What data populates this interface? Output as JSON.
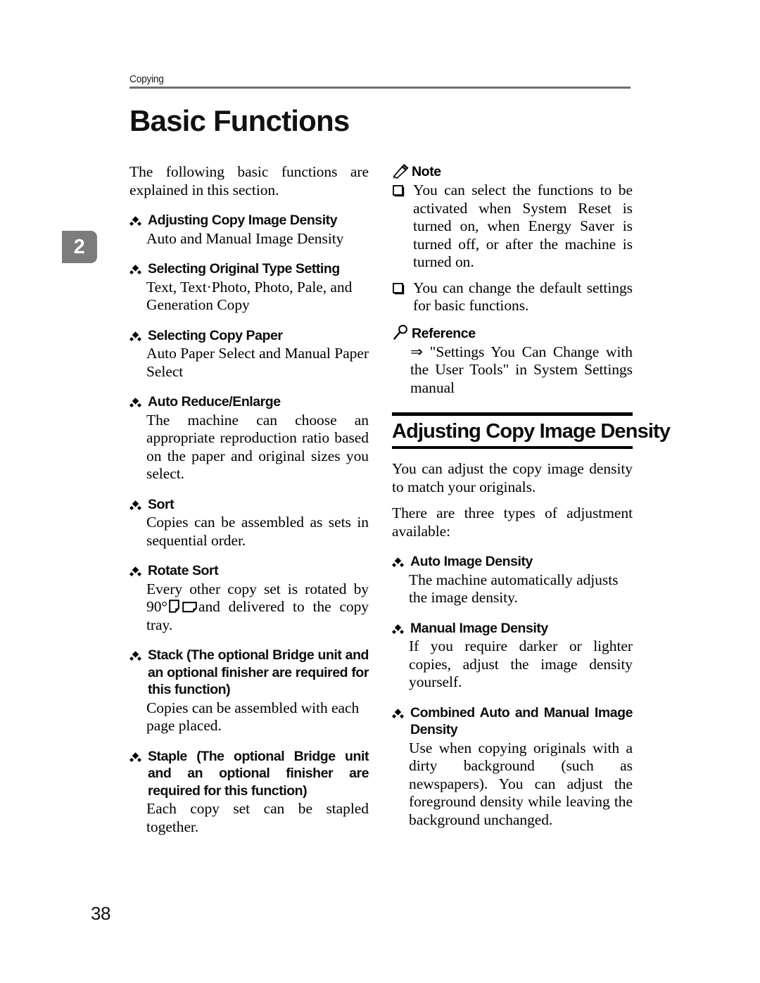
{
  "document": {
    "running_header": "Copying",
    "page_title": "Basic Functions",
    "chapter_number": "2",
    "folio": "38"
  },
  "left_column": {
    "intro": "The following basic functions are explained in this section.",
    "items": [
      {
        "heading": "Adjusting Copy Image Density",
        "body": "Auto and Manual Image Density"
      },
      {
        "heading": "Selecting Original Type Setting",
        "body": "Text, Text·Photo, Photo, Pale, and Generation Copy"
      },
      {
        "heading": "Selecting Copy Paper",
        "body": "Auto Paper Select and Manual Paper Select"
      },
      {
        "heading": "Auto Reduce/Enlarge",
        "body": "The machine can choose an appropriate reproduction ratio based on the paper and original sizes you select."
      },
      {
        "heading": "Sort",
        "body": "Copies can be assembled as sets in sequential order."
      },
      {
        "heading": "Rotate Sort",
        "body_prefix": "Every other copy set is rotated by 90°",
        "body_suffix": "and delivered to the copy tray."
      },
      {
        "heading": "Stack (The optional Bridge unit and an optional finisher are required for this function)",
        "body": "Copies can be assembled with each page placed."
      },
      {
        "heading": "Staple (The optional Bridge unit and an optional finisher are required for this function)",
        "body": "Each copy set can be stapled together."
      }
    ]
  },
  "right_column": {
    "note": {
      "label": "Note",
      "items": [
        "You can select the functions to be activated when System Reset is turned on, when Energy Saver is turned off, or after the machine is turned on.",
        "You can change the default settings for basic functions."
      ]
    },
    "reference": {
      "label": "Reference",
      "body": "⇒ \"Settings You Can Change with the User Tools\" in System Settings manual"
    },
    "section": {
      "heading": "Adjusting Copy Image Density",
      "paragraphs": [
        "You can adjust the copy image density to match your originals.",
        "There are three types of adjustment available:"
      ],
      "items": [
        {
          "heading": "Auto Image Density",
          "body": "The machine automatically adjusts the image density."
        },
        {
          "heading": "Manual Image Density",
          "body": "If you require darker or lighter copies, adjust the image density yourself."
        },
        {
          "heading": "Combined Auto and Manual Image Density",
          "body": "Use when copying originals with a dirty background (such as newspapers). You can adjust the foreground density while leaving the background unchanged."
        }
      ]
    }
  },
  "icons": {
    "diamond_bullet": "diamond-bullet-icon",
    "square_bullet": "square-bullet-icon",
    "note": "pencil-icon",
    "reference": "magnifier-icon",
    "paper_portrait": "paper-portrait-icon",
    "paper_landscape": "paper-landscape-icon"
  },
  "colors": {
    "chapter_tab_bg": "#7c7c7c",
    "header_rule": "#6e6e6e",
    "text": "#000000"
  }
}
